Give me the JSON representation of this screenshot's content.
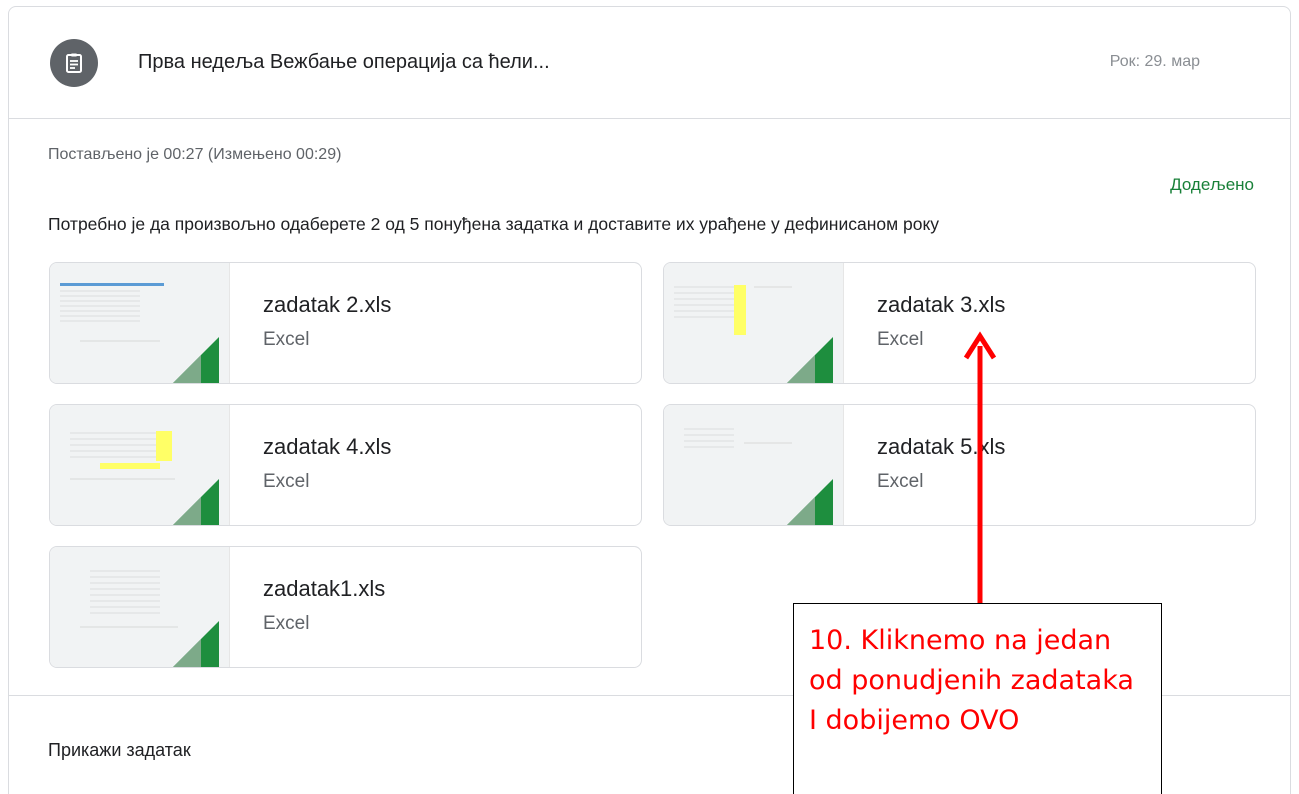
{
  "assignment": {
    "title": "Прва недеља Вежбање операција са ћели...",
    "due": "Рок: 29. мар",
    "posted": "Постављено је 00:27 (Измењено 00:29)",
    "status": "Додељено",
    "status_color": "#188038",
    "icon": "assignment-icon",
    "description": "Потребно је да произвољно одаберете 2 од 5 понуђена задатка и доставите их урађене у дефинисаном року"
  },
  "attachments": [
    {
      "name": "zadatak 2.xls",
      "type": "Excel"
    },
    {
      "name": "zadatak 3.xls",
      "type": "Excel"
    },
    {
      "name": "zadatak 4.xls",
      "type": "Excel"
    },
    {
      "name": "zadatak 5.xls",
      "type": "Excel"
    },
    {
      "name": "zadatak1.xls",
      "type": "Excel"
    }
  ],
  "footer": {
    "view_label": "Прикажи задатак"
  },
  "annotation": {
    "text": "10. Kliknemo na jedan od ponudjenih zadataka I dobijemo OVO",
    "color": "#ff0000"
  }
}
